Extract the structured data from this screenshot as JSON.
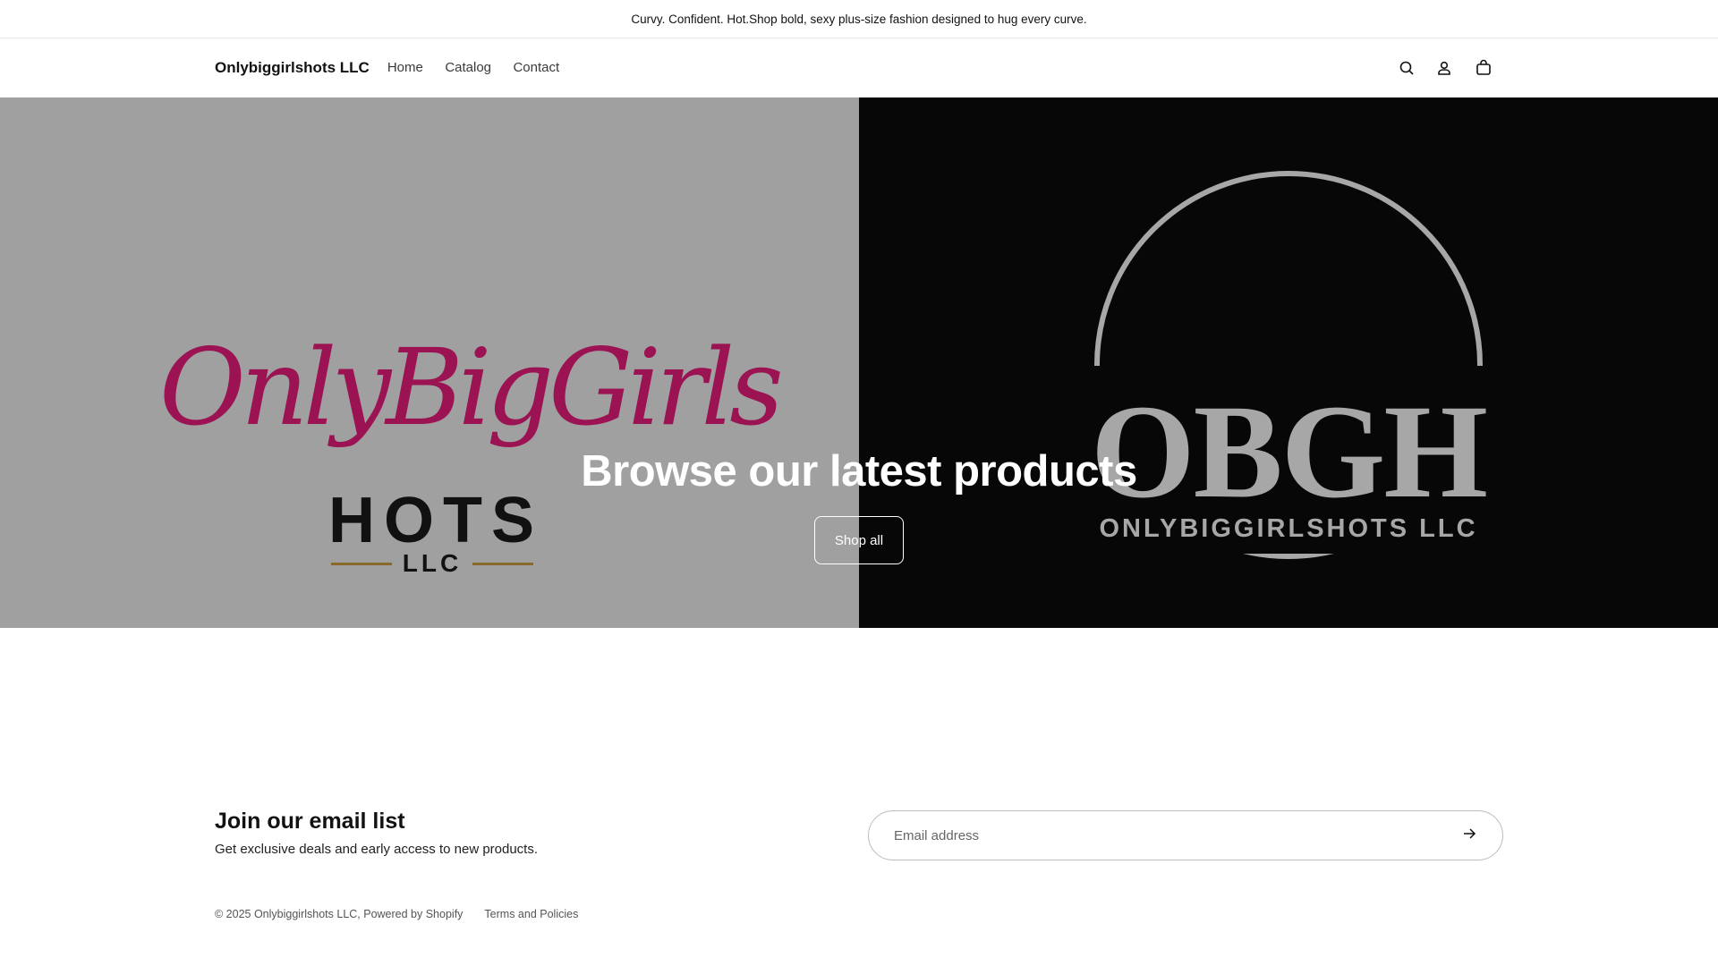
{
  "announcement": "Curvy. Confident. Hot.Shop bold, sexy plus-size fashion designed to hug every curve.",
  "header": {
    "store_name": "Onlybiggirlshots LLC",
    "nav": [
      "Home",
      "Catalog",
      "Contact"
    ],
    "icons": [
      "search-icon",
      "account-icon",
      "cart-icon"
    ]
  },
  "hero": {
    "left_logo": {
      "script": "OnlyBigGirls",
      "hots": "HOTS",
      "llc": "LLC"
    },
    "right_logo": {
      "monogram": "OBGH",
      "name": "ONLYBIGGIRLSHOTS LLC"
    },
    "heading": "Browse our latest products",
    "button": "Shop all"
  },
  "newsletter": {
    "heading": "Join our email list",
    "subtext": "Get exclusive deals and early access to new products.",
    "placeholder": "Email address"
  },
  "footer": {
    "copyright": "© 2025 Onlybiggirlshots LLC, Powered by Shopify",
    "policies": "Terms and Policies"
  },
  "colors": {
    "brand_magenta": "#9c1353",
    "hero_left": "#a0a0a0",
    "hero_right": "#070707"
  }
}
